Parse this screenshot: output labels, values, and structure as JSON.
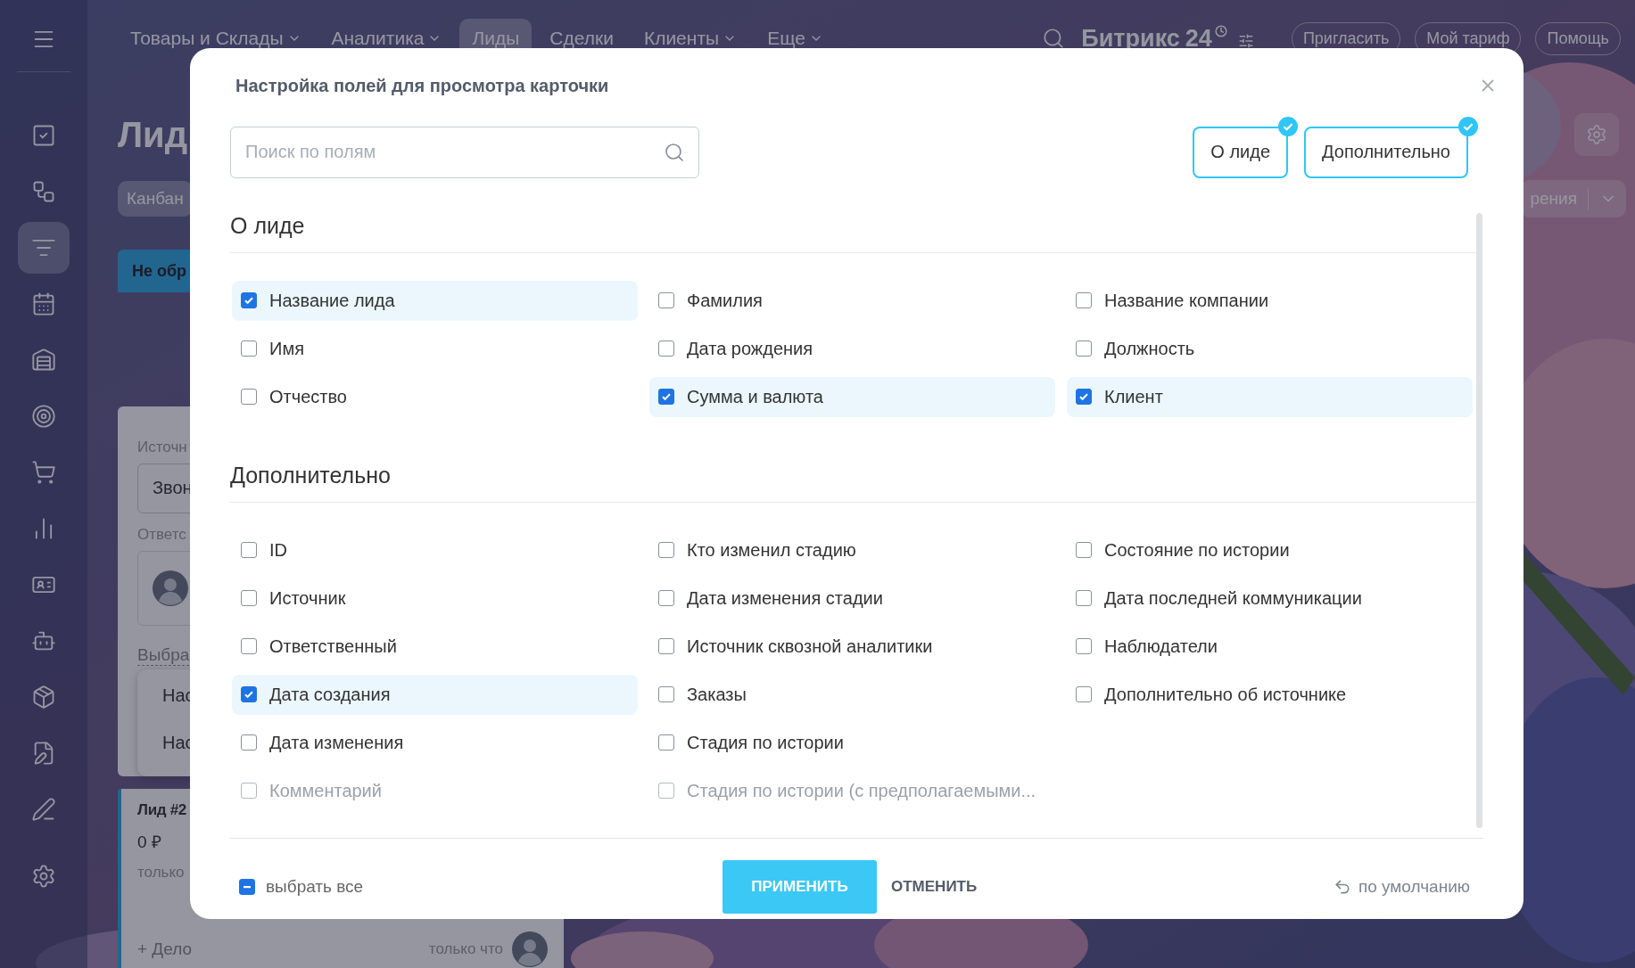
{
  "sidebar": {
    "items": [
      {
        "selected": false
      },
      {
        "selected": false
      },
      {
        "selected": true
      },
      {
        "selected": false
      },
      {
        "selected": false
      },
      {
        "selected": false
      },
      {
        "selected": false
      },
      {
        "selected": false
      },
      {
        "selected": false
      },
      {
        "selected": false
      },
      {
        "selected": false
      },
      {
        "selected": false
      },
      {
        "selected": false
      },
      {
        "selected": false
      }
    ]
  },
  "top_nav": {
    "items": [
      {
        "label": "Товары и Склады",
        "dropdown": true,
        "selected": false
      },
      {
        "label": "Аналитика",
        "dropdown": true,
        "selected": false
      },
      {
        "label": "Лиды",
        "dropdown": false,
        "selected": true
      },
      {
        "label": "Сделки",
        "dropdown": false,
        "selected": false
      },
      {
        "label": "Клиенты",
        "dropdown": true,
        "selected": false
      },
      {
        "label": "Еще",
        "dropdown": true,
        "selected": false
      }
    ],
    "logo": {
      "name": "Битрикс",
      "number": "24"
    },
    "buttons": [
      "Пригласить",
      "Мой тариф",
      "Помощь"
    ]
  },
  "page": {
    "title": "Лид",
    "view_tab": "Канбан",
    "view_menu": "рения"
  },
  "board": {
    "column_title": "Не обр",
    "card": {
      "source_label": "Источн",
      "source_value": "Звон",
      "responsible_label": "Ответс",
      "select_link": "Выбра",
      "menu_items": [
        "Нас",
        "Нас"
      ]
    },
    "lead_card": {
      "title": "Лид #2",
      "amount": "0 ₽",
      "time": "только",
      "add_activity": "+ Дело",
      "activity_time": "только что"
    }
  },
  "dialog": {
    "title": "Настройка полей для просмотра карточки",
    "search": {
      "placeholder": "Поиск по полям"
    },
    "chips": [
      {
        "label": "О лиде",
        "selected": true
      },
      {
        "label": "Дополнительно",
        "selected": true
      }
    ],
    "sections": [
      {
        "title": "О лиде",
        "columns": [
          [
            {
              "label": "Название лида",
              "checked": true
            },
            {
              "label": "Имя",
              "checked": false
            },
            {
              "label": "Отчество",
              "checked": false
            }
          ],
          [
            {
              "label": "Фамилия",
              "checked": false
            },
            {
              "label": "Дата рождения",
              "checked": false
            },
            {
              "label": "Сумма и валюта",
              "checked": true
            }
          ],
          [
            {
              "label": "Название компании",
              "checked": false
            },
            {
              "label": "Должность",
              "checked": false
            },
            {
              "label": "Клиент",
              "checked": true
            }
          ]
        ]
      },
      {
        "title": "Дополнительно",
        "columns": [
          [
            {
              "label": "ID",
              "checked": false
            },
            {
              "label": "Источник",
              "checked": false
            },
            {
              "label": "Ответственный",
              "checked": false
            },
            {
              "label": "Дата создания",
              "checked": true
            },
            {
              "label": "Дата изменения",
              "checked": false
            },
            {
              "label": "Комментарий",
              "checked": false
            }
          ],
          [
            {
              "label": "Кто изменил стадию",
              "checked": false
            },
            {
              "label": "Дата изменения стадии",
              "checked": false
            },
            {
              "label": "Источник сквозной аналитики",
              "checked": false
            },
            {
              "label": "Заказы",
              "checked": false
            },
            {
              "label": "Стадия по истории",
              "checked": false
            },
            {
              "label": "Стадия по истории (с предполагаемыми...",
              "checked": false
            }
          ],
          [
            {
              "label": "Состояние по истории",
              "checked": false
            },
            {
              "label": "Дата последней коммуникации",
              "checked": false
            },
            {
              "label": "Наблюдатели",
              "checked": false
            },
            {
              "label": "Дополнительно об источнике",
              "checked": false
            }
          ]
        ]
      }
    ],
    "select_all": {
      "label": "выбрать все",
      "indeterminate": true
    },
    "buttons": {
      "apply": "ПРИМЕНИТЬ",
      "cancel": "ОТМЕНИТЬ",
      "reset": "по умолчанию"
    }
  }
}
